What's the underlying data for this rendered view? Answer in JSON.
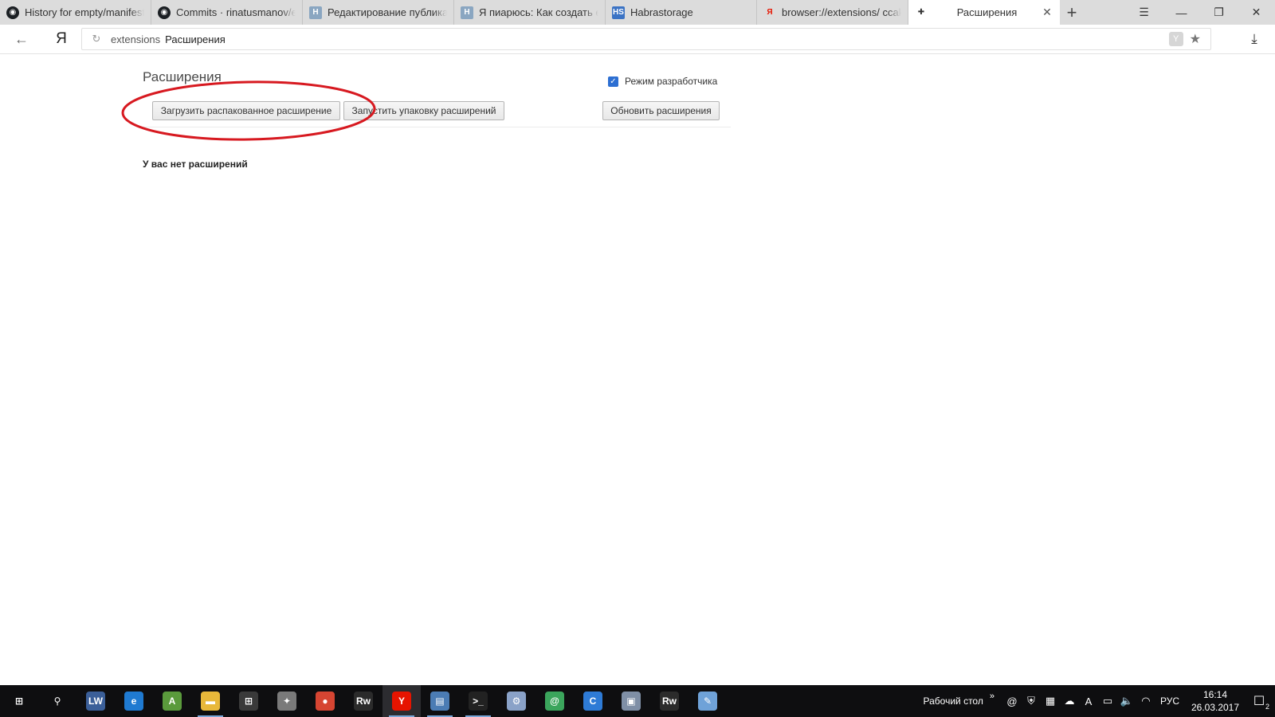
{
  "browser": {
    "tabs": [
      {
        "title": "History for empty/manifest",
        "favicon": "github-icon",
        "active": false
      },
      {
        "title": "Commits · rinatusmanov/er",
        "favicon": "github-icon",
        "active": false
      },
      {
        "title": "Редактирование публикац",
        "favicon": "habr-icon",
        "favicon_text": "H",
        "active": false
      },
      {
        "title": "Я пиарюсь: Как создать ex",
        "favicon": "habr-icon",
        "favicon_text": "H",
        "active": false
      },
      {
        "title": "Habrastorage",
        "favicon": "habrastorage-icon",
        "favicon_text": "HS",
        "active": false
      },
      {
        "title": "browser://extensions/ ccak",
        "favicon": "yandex-icon",
        "favicon_text": "Я",
        "active": false
      },
      {
        "title": "Расширения",
        "favicon": "puzzle-icon",
        "active": true
      }
    ],
    "new_tab_symbol": "+",
    "window_controls": {
      "menu": "☰",
      "minimize": "—",
      "restore": "❐",
      "close": "✕"
    },
    "address": {
      "back_symbol": "←",
      "logo": "Я",
      "reload_symbol": "↻",
      "host": "extensions",
      "page_title": "Расширения",
      "protect_symbol": "Y",
      "star_symbol": "★",
      "download_symbol": "⤓"
    }
  },
  "page": {
    "title": "Расширения",
    "developer_mode": {
      "label": "Режим разработчика",
      "checked": true,
      "check_symbol": "✓"
    },
    "buttons": {
      "load_unpacked": "Загрузить распакованное расширение",
      "pack": "Запустить упаковку расширений",
      "update": "Обновить расширения"
    },
    "empty_message": "У вас нет расширений",
    "annotation": {
      "shape": "ellipse",
      "color": "#d71920",
      "target": "load_unpacked"
    }
  },
  "taskbar": {
    "apps": [
      {
        "name": "windows-start-icon",
        "text": "⊞",
        "color": "#0e0e10",
        "running": false
      },
      {
        "name": "search-icon",
        "text": "⚲",
        "color": "#0e0e10",
        "running": false
      },
      {
        "name": "lw-app-icon",
        "text": "LW",
        "color": "#3b5f99",
        "running": false
      },
      {
        "name": "edge-icon",
        "text": "e",
        "color": "#1f7ad1",
        "running": false
      },
      {
        "name": "android-studio-icon",
        "text": "A",
        "color": "#5a9a3c",
        "running": false
      },
      {
        "name": "file-explorer-icon",
        "text": "▬",
        "color": "#e8b83a",
        "running": true
      },
      {
        "name": "store-icon",
        "text": "⊞",
        "color": "#3a3a3a",
        "running": false
      },
      {
        "name": "game-icon",
        "text": "✦",
        "color": "#7a7a7a",
        "running": false
      },
      {
        "name": "chrome-icon",
        "text": "●",
        "color": "#d64532",
        "running": false
      },
      {
        "name": "rw-app-icon",
        "text": "Rw",
        "color": "#2b2b2b",
        "running": false
      },
      {
        "name": "yandex-browser-icon",
        "text": "Y",
        "color": "#e61400",
        "running": true,
        "active": true
      },
      {
        "name": "notepad-icon",
        "text": "▤",
        "color": "#4b7cb4",
        "running": true
      },
      {
        "name": "terminal-icon",
        "text": ">_",
        "color": "#222222",
        "running": true
      },
      {
        "name": "settings-app-icon",
        "text": "⚙",
        "color": "#8aa2c8",
        "running": false
      },
      {
        "name": "icq-icon",
        "text": "@",
        "color": "#3ba55c",
        "running": false
      },
      {
        "name": "cobian-icon",
        "text": "C",
        "color": "#2e7bd6",
        "running": false
      },
      {
        "name": "control-panel-icon",
        "text": "▣",
        "color": "#7f8fa6",
        "running": false
      },
      {
        "name": "rw-app-2-icon",
        "text": "Rw",
        "color": "#2b2b2b",
        "running": false
      },
      {
        "name": "paint-icon",
        "text": "✎",
        "color": "#6fa2d8",
        "running": false
      }
    ],
    "tray": {
      "desktop_label": "Рабочий стол",
      "chevron": "»",
      "icons": [
        {
          "name": "mail-agent-icon",
          "text": "@"
        },
        {
          "name": "defender-icon",
          "text": "⛨"
        },
        {
          "name": "network-drive-icon",
          "text": "▦"
        },
        {
          "name": "onedrive-icon",
          "text": "☁"
        },
        {
          "name": "adobe-icon",
          "text": "A"
        },
        {
          "name": "battery-icon",
          "text": "▭"
        },
        {
          "name": "volume-icon",
          "text": "🔈"
        },
        {
          "name": "wifi-icon",
          "text": "◠"
        }
      ],
      "language": "РУС",
      "time": "16:14",
      "date": "26.03.2017",
      "notifications_count": "2",
      "notification_symbol": "☐"
    }
  }
}
